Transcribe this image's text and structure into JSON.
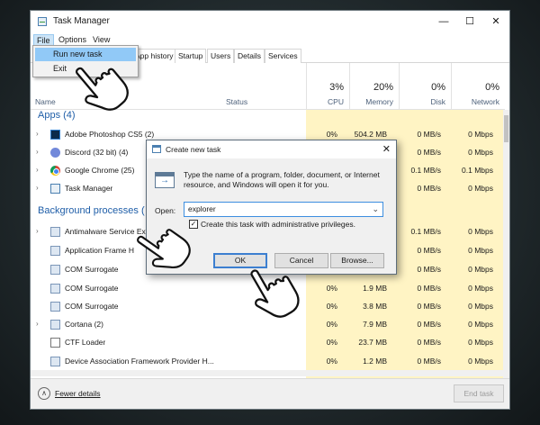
{
  "window": {
    "title": "Task Manager",
    "minimize_glyph": "—",
    "maximize_glyph": "☐",
    "close_glyph": "✕"
  },
  "menu": {
    "file": "File",
    "options": "Options",
    "view": "View",
    "file_items": [
      "Run new task",
      "Exit"
    ]
  },
  "tabs": [
    "App history",
    "Startup",
    "Users",
    "Details",
    "Services"
  ],
  "columns": {
    "name": "Name",
    "status": "Status",
    "cpu": {
      "pct": "3%",
      "label": "CPU"
    },
    "memory": {
      "pct": "20%",
      "label": "Memory"
    },
    "disk": {
      "pct": "0%",
      "label": "Disk"
    },
    "network": {
      "pct": "0%",
      "label": "Network"
    }
  },
  "sections": {
    "apps": "Apps (4)",
    "background": "Background processes ("
  },
  "apps": [
    {
      "name": "Adobe Photoshop CS5 (2)",
      "icon": "photoshop-icon",
      "cpu": "0%",
      "memory": "504.2 MB",
      "disk": "0 MB/s",
      "network": "0 Mbps"
    },
    {
      "name": "Discord (32 bit) (4)",
      "icon": "discord-icon",
      "cpu": "",
      "memory": "",
      "disk": "0 MB/s",
      "network": "0 Mbps"
    },
    {
      "name": "Google Chrome (25)",
      "icon": "chrome-icon",
      "cpu": "",
      "memory": "",
      "disk": "0.1 MB/s",
      "network": "0.1 Mbps"
    },
    {
      "name": "Task Manager",
      "icon": "task-manager-icon",
      "cpu": "",
      "memory": "",
      "disk": "0 MB/s",
      "network": "0 Mbps"
    }
  ],
  "background": [
    {
      "name": "Antimalware Service Ex",
      "icon": "window-icon",
      "cpu": "",
      "memory": "",
      "disk": "0.1 MB/s",
      "network": "0 Mbps",
      "chevron": true
    },
    {
      "name": "Application Frame H",
      "icon": "window-icon",
      "cpu": "",
      "memory": "",
      "disk": "0 MB/s",
      "network": "0 Mbps",
      "chevron": false
    },
    {
      "name": "COM Surrogate",
      "icon": "window-icon",
      "cpu": "",
      "memory": "",
      "disk": "0 MB/s",
      "network": "0 Mbps",
      "chevron": false
    },
    {
      "name": "COM Surrogate",
      "icon": "window-icon",
      "cpu": "0%",
      "memory": "1.9 MB",
      "disk": "0 MB/s",
      "network": "0 Mbps",
      "chevron": false
    },
    {
      "name": "COM Surrogate",
      "icon": "window-icon",
      "cpu": "0%",
      "memory": "3.8 MB",
      "disk": "0 MB/s",
      "network": "0 Mbps",
      "chevron": false
    },
    {
      "name": "Cortana (2)",
      "icon": "window-icon",
      "cpu": "0%",
      "memory": "7.9 MB",
      "disk": "0 MB/s",
      "network": "0 Mbps",
      "chevron": true
    },
    {
      "name": "CTF Loader",
      "icon": "ctf-icon",
      "cpu": "0%",
      "memory": "23.7 MB",
      "disk": "0 MB/s",
      "network": "0 Mbps",
      "chevron": false
    },
    {
      "name": "Device Association Framework Provider H...",
      "icon": "window-icon",
      "cpu": "0%",
      "memory": "1.2 MB",
      "disk": "0 MB/s",
      "network": "0 Mbps",
      "chevron": false
    }
  ],
  "footer": {
    "fewer_details": "Fewer details",
    "end_task": "End task"
  },
  "dialog": {
    "title": "Create new task",
    "description": "Type the name of a program, folder, document, or Internet resource, and Windows will open it for you.",
    "open_label": "Open:",
    "open_value": "explorer",
    "admin_label": "Create this task with administrative privileges.",
    "admin_checked": true,
    "ok": "OK",
    "cancel": "Cancel",
    "browse": "Browse..."
  },
  "colors": {
    "heat": "#fff4c4",
    "accent_blue": "#1f5ea8",
    "menu_highlight": "#91c9f7"
  }
}
